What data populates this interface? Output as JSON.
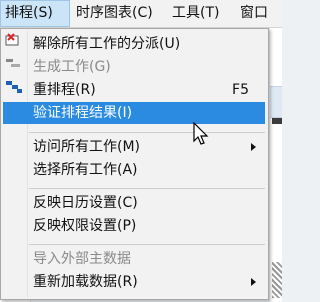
{
  "menubar": {
    "items": [
      {
        "label": "排程(S)",
        "active": true
      },
      {
        "label": "时序图表(C)",
        "active": false
      },
      {
        "label": "工具(T)",
        "active": false
      },
      {
        "label": "窗口",
        "active": false
      }
    ]
  },
  "dropdown": {
    "items": [
      {
        "label": "解除所有工作的分派(U)",
        "state": "normal"
      },
      {
        "label": "生成工作(G)",
        "state": "disabled"
      },
      {
        "label": "重排程(R)",
        "shortcut": "F5",
        "state": "normal"
      },
      {
        "label": "验证排程结果(I)",
        "state": "highlighted"
      },
      {
        "label": "访问所有工作(M)",
        "state": "normal",
        "submenu": true
      },
      {
        "label": "选择所有工作(A)",
        "state": "normal"
      },
      {
        "label": "反映日历设置(C)",
        "state": "normal"
      },
      {
        "label": "反映权限设置(P)",
        "state": "normal"
      },
      {
        "label": "导入外部主数据",
        "state": "disabled"
      },
      {
        "label": "重新加载数据(R)",
        "state": "normal",
        "submenu": true
      }
    ]
  },
  "colors": {
    "highlight": "#2a8be0",
    "disabled_text": "#8a8a8a",
    "menu_bg": "#f2f2f2"
  }
}
